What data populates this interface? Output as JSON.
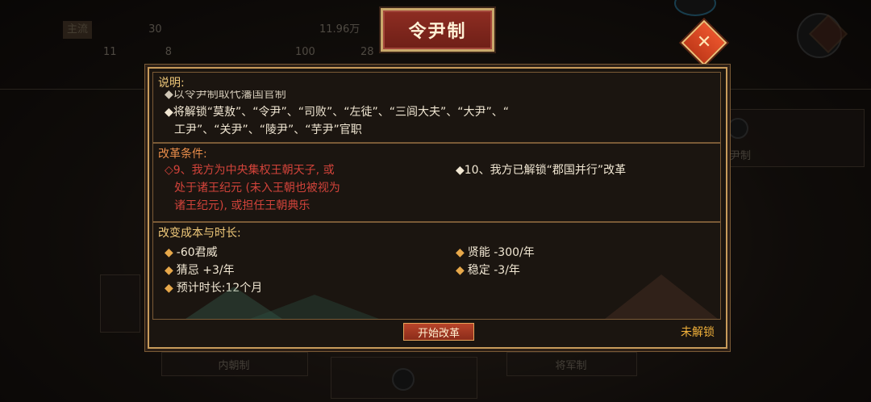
{
  "background": {
    "stats": [
      {
        "tag": "主流",
        "tag2": "",
        "value": "30"
      },
      {
        "tag": "",
        "value": "11"
      },
      {
        "tag": "",
        "value": "8"
      },
      {
        "tag": "",
        "value": "11.96万"
      },
      {
        "tag": "",
        "value": "100"
      },
      {
        "tag": "",
        "value": "28"
      }
    ],
    "labels": {
      "right_tab": "尹制",
      "bottom_left": "内朝制",
      "bottom_right": "将军制"
    }
  },
  "title": "令尹制",
  "description": {
    "heading": "说明:",
    "line0": "◆以令尹制取代藩国官制",
    "line1": "◆将解锁“莫敖”、“令尹”、“司败”、“左徒”、“三闾大夫”、“大尹”、“",
    "line2": "工尹”、“关尹”、“陵尹”、“芋尹”官职"
  },
  "conditions": {
    "heading": "改革条件:",
    "left_line1": "◇9、我方为中央集权王朝天子, 或",
    "left_line2": "处于诸王纪元 (未入王朝也被视为",
    "left_line3": "诸王纪元), 或担任王朝典乐",
    "right_line1": "◆10、我方已解锁“郡国并行”改革"
  },
  "cost": {
    "heading": "改变成本与时长:",
    "items": [
      {
        "text": "-60君威"
      },
      {
        "text": "贤能 -300/年"
      },
      {
        "text": "猜忌 +3/年"
      },
      {
        "text": "稳定 -3/年"
      },
      {
        "text": "预计时长:12个月"
      }
    ]
  },
  "footer": {
    "start_button": "开始改革",
    "status": "未解锁"
  },
  "colors": {
    "accent_gold": "#c89b5b",
    "title_red": "#8e2d22",
    "locked_orange": "#f0b03a",
    "condition_red": "#d2433a"
  }
}
